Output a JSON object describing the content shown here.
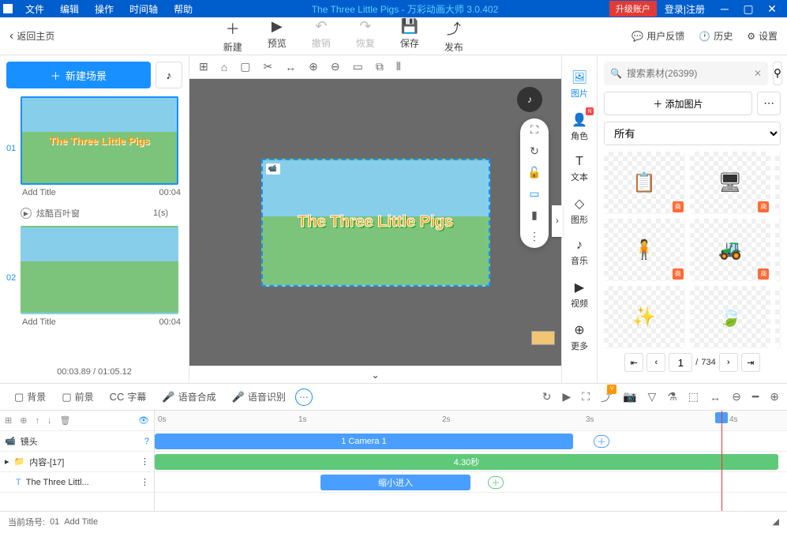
{
  "titlebar": {
    "menus": [
      "文件",
      "编辑",
      "操作",
      "时间轴",
      "帮助"
    ],
    "title": "The Three Little Pigs - 万彩动画大师 3.0.402",
    "upgrade": "升级账户",
    "login": "登录|注册"
  },
  "main_toolbar": {
    "back": "返回主页",
    "buttons": [
      {
        "label": "新建",
        "icon": "＋"
      },
      {
        "label": "预览",
        "icon": "▶"
      },
      {
        "label": "撤销",
        "icon": "↶",
        "disabled": true
      },
      {
        "label": "恢复",
        "icon": "↷",
        "disabled": true
      },
      {
        "label": "保存",
        "icon": "💾"
      },
      {
        "label": "发布",
        "icon": "⤴"
      }
    ],
    "right": [
      {
        "label": "用户反馈",
        "icon": "💬"
      },
      {
        "label": "历史",
        "icon": "🕐"
      },
      {
        "label": "设置",
        "icon": "⚙"
      }
    ]
  },
  "scene_panel": {
    "new_scene": "新建场景",
    "scenes": [
      {
        "num": "01",
        "title": "Add Title",
        "duration": "00:04",
        "thumb_text": "The Three Little Pigs"
      },
      {
        "num": "02",
        "title": "Add Title",
        "duration": "00:04",
        "thumb_text": ""
      }
    ],
    "transition": {
      "name": "炫酷百叶窗",
      "duration": "1(s)"
    },
    "time_current": "00:03.89",
    "time_total": "01:05.12"
  },
  "canvas": {
    "stage_title": "The Three Little Pigs"
  },
  "right_tabs": [
    {
      "label": "图片",
      "icon": "🖼",
      "active": true
    },
    {
      "label": "角色",
      "icon": "👤",
      "badge": "N"
    },
    {
      "label": "文本",
      "icon": "T"
    },
    {
      "label": "图形",
      "icon": "◇"
    },
    {
      "label": "音乐",
      "icon": "♪"
    },
    {
      "label": "视频",
      "icon": "▶"
    },
    {
      "label": "更多",
      "icon": "⊕"
    }
  ],
  "asset_panel": {
    "search_placeholder": "搜索素材(26399)",
    "add_image": "＋ 添加图片",
    "category": "所有",
    "assets": [
      "📋",
      "🖥",
      "📦",
      "🧍",
      "🚜",
      "🎊",
      "✨",
      "🍃",
      "📄"
    ],
    "page": "1",
    "total_pages": "734"
  },
  "timeline": {
    "tabs": [
      {
        "label": "背景",
        "icon": "▢"
      },
      {
        "label": "前景",
        "icon": "▢"
      },
      {
        "label": "字幕",
        "icon": "CC"
      },
      {
        "label": "语音合成",
        "icon": "🎤"
      },
      {
        "label": "语音识别",
        "icon": "🎤"
      }
    ],
    "ruler": [
      "0s",
      "1s",
      "2s",
      "3s",
      "4s"
    ],
    "tracks": {
      "camera": {
        "label": "镜头",
        "clip": "1 Camera 1"
      },
      "content": {
        "label": "内容-[17]",
        "clip": "4.30秒"
      },
      "text": {
        "label": "The Three Littl...",
        "clip": "缩小进入"
      }
    }
  },
  "statusbar": {
    "scene_label": "当前场号:",
    "scene_num": "01",
    "scene_title": "Add Title"
  }
}
